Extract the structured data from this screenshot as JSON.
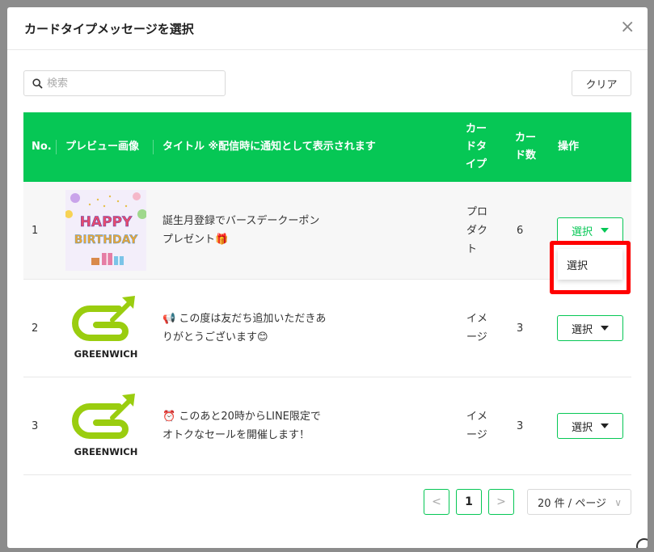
{
  "modal": {
    "title": "カードタイプメッセージを選択",
    "close_icon": "×"
  },
  "search": {
    "placeholder": "検索",
    "value": "",
    "icon": "search-icon"
  },
  "toolbar": {
    "clear_label": "クリア"
  },
  "table": {
    "headers": {
      "no": "No.",
      "preview": "プレビュー画像",
      "title": "タイトル ※配信時に通知として表示されます",
      "card_type": "カードタイプ",
      "card_count": "カード数",
      "action": "操作"
    },
    "rows": [
      {
        "no": "1",
        "title": "誕生月登録でバースデークーポンプレゼント🎁",
        "card_type": "プロダクト",
        "card_count": "6",
        "action_label": "選択",
        "thumbnail": "happy-birthday"
      },
      {
        "no": "2",
        "title": "📢 この度は友だち追加いただきありがとうございます😊",
        "card_type": "イメージ",
        "card_count": "3",
        "action_label": "選択",
        "thumbnail": "greenwich-logo"
      },
      {
        "no": "3",
        "title": "⏰ このあと20時からLINE限定でオトクなセールを開催します！",
        "card_type": "イメージ",
        "card_count": "3",
        "action_label": "選択",
        "thumbnail": "greenwich-logo"
      }
    ]
  },
  "dropdown": {
    "item_label": "選択"
  },
  "pagination": {
    "prev": "<",
    "current": "1",
    "next": ">",
    "page_size": "20 件 / ページ"
  },
  "logo_text": "GREENWICH",
  "thumbnail_text": {
    "happy": "HAPPY",
    "birthday": "BIRTHDAY"
  },
  "colors": {
    "accent": "#06c755",
    "highlight": "#ff0000",
    "logo_green": "#9acd0f"
  }
}
